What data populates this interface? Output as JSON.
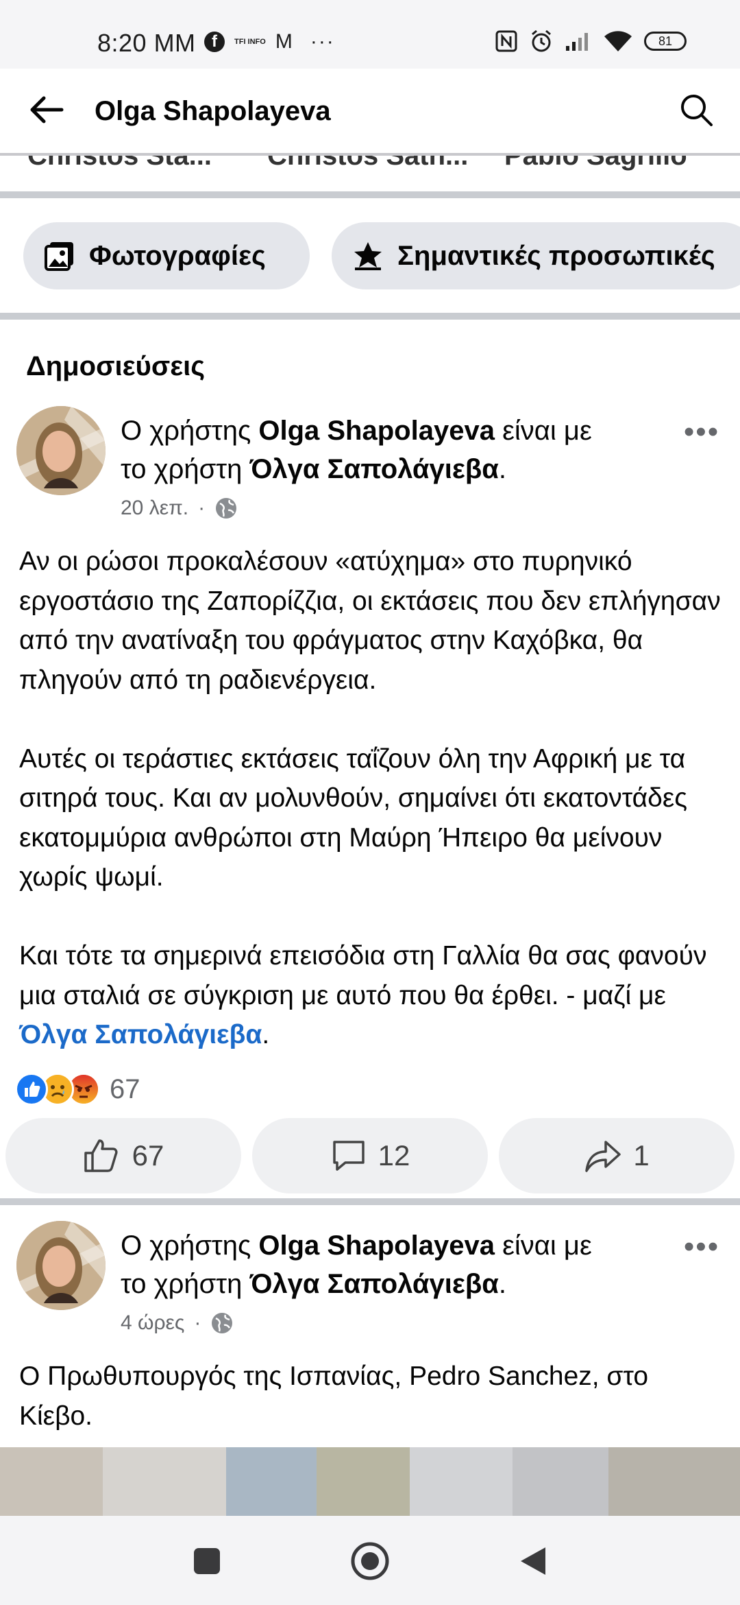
{
  "status_bar": {
    "time": "8:20 MM",
    "info_label": "TFI INFO",
    "mail_glyph": "M",
    "more_dots": "···",
    "battery": "81"
  },
  "header": {
    "title": "Olga Shapolayeva"
  },
  "cut_tabs": [
    "Christos Sta...",
    "Christos Sath...",
    "Pablo Sagrillo"
  ],
  "filters": {
    "photos_label": "Φωτογραφίες",
    "featured_label": "Σημαντικές προσωπικές"
  },
  "section_title": "Δημοσιεύσεις",
  "posts": [
    {
      "prefix": "Ο χρήστης ",
      "author": "Olga Shapolayeva",
      "middle": " είναι με",
      "line2_prefix": "το χρήστη ",
      "tagged": "Όλγα Σαπολάγιεβα",
      "suffix": ".",
      "time": "20 λεπ.",
      "separator": "·",
      "body": [
        "Αν οι ρώσοι προκαλέσουν «ατύχημα» στο πυρηνικό εργοστάσιο της Ζαπορίζζια, οι εκτάσεις που δεν επλήγησαν από την ανατίναξη του φράγματος στην Καχόβκα, θα πληγούν από τη ραδιενέργεια.",
        "Αυτές οι τεράστιες εκτάσεις ταΐζουν όλη την Αφρική με τα σιτηρά τους. Και αν μολυνθούν, σημαίνει ότι εκατοντάδες εκατομμύρια ανθρώποι στη Μαύρη Ήπειρο θα μείνουν χωρίς ψωμί.",
        "Και τότε τα σημερινά επεισόδια στη Γαλλία θα σας φανούν μια σταλιά σε σύγκριση με αυτό που θα έρθει. - μαζί με "
      ],
      "body_tag": "Όλγα Σαπολάγιεβα",
      "body_tag_suffix": ".",
      "reaction_count": "67",
      "like_count": "67",
      "comment_count": "12",
      "share_count": "1"
    },
    {
      "prefix": "Ο χρήστης ",
      "author": "Olga Shapolayeva",
      "middle": " είναι με",
      "line2_prefix": "το χρήστη ",
      "tagged": "Όλγα Σαπολάγιεβα",
      "suffix": ".",
      "time": "4 ώρες",
      "separator": "·",
      "body": [
        "Ο Πρωθυπουργός της Ισπανίας, Pedro Sanchez, στο Κίεβο."
      ]
    }
  ],
  "colors": {
    "link_blue": "#1b6ac9",
    "like_blue": "#1877f2",
    "pill_bg": "#e4e6eb",
    "divider": "#c9ccd1"
  }
}
